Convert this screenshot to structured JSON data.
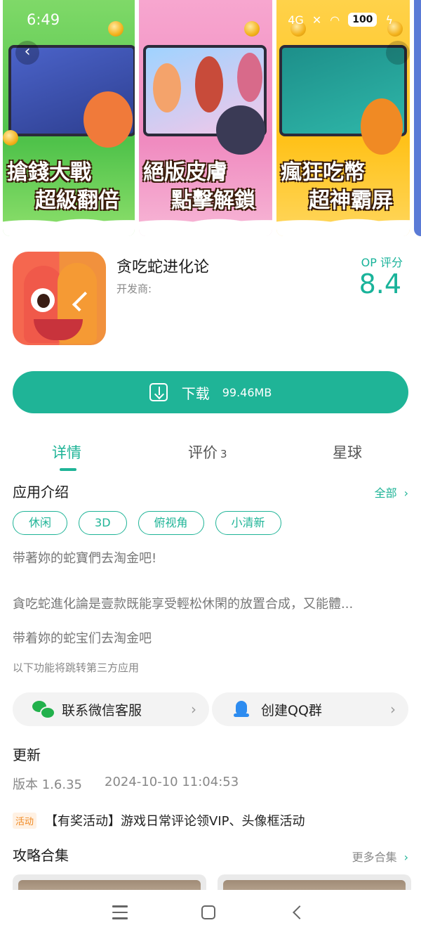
{
  "status_bar": {
    "time": "6:49",
    "network": "4G",
    "battery": "100"
  },
  "banner": {
    "cards": [
      {
        "line1": "搶錢大戰",
        "line2": "超級翻倍"
      },
      {
        "line1": "絕版皮膚",
        "line2": "點擊解鎖"
      },
      {
        "line1": "瘋狂吃幣",
        "line2": "超神霸屏"
      }
    ]
  },
  "app": {
    "title": "贪吃蛇进化论",
    "developer_label": "开发商:",
    "score_label": "OP 评分",
    "score_value": "8.4"
  },
  "download": {
    "label": "下载",
    "size": "99.46MB"
  },
  "tabs": {
    "detail": "详情",
    "review": "评价",
    "review_count": "3",
    "planet": "星球"
  },
  "intro": {
    "title": "应用介绍",
    "see_all": "全部",
    "tags": [
      "休闲",
      "3D",
      "俯视角",
      "小清新"
    ],
    "desc_line1": "带著妳的蛇寶們去淘金吧!",
    "desc_line2": "貪吃蛇進化論是壹款既能享受輕松休閑的放置合成，又能體...",
    "desc_line3": "带着妳的蛇宝们去淘金吧",
    "third_party_note": "以下功能将跳转第三方应用"
  },
  "contacts": {
    "wechat": "联系微信客服",
    "qq": "创建QQ群"
  },
  "update": {
    "title": "更新",
    "version": "版本 1.6.35",
    "date": "2024-10-10 11:04:53"
  },
  "activity": {
    "badge": "活动",
    "text": "【有奖活动】游戏日常评论领VIP、头像框活动"
  },
  "guides": {
    "title": "攻略合集",
    "more": "更多合集"
  },
  "colors": {
    "accent": "#1fb497",
    "activity_badge": "#f08a24"
  }
}
